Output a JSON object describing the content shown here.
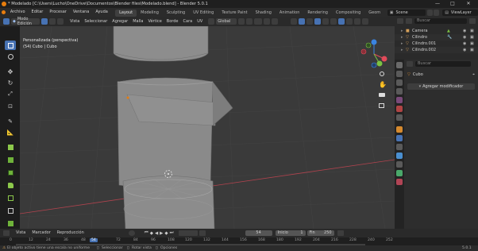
{
  "window": {
    "title": "* Modelado [C:\\Users\\Lucho\\OneDrive\\Documentos\\Blender files\\Modelado.blend] - Blender 5.0.1",
    "minimize": "—",
    "maximize": "□",
    "close": "✕"
  },
  "menubar": {
    "items": [
      "Archivo",
      "Editar",
      "Procesar",
      "Ventana",
      "Ayuda"
    ],
    "workspaces": [
      "Layout",
      "Modeling",
      "Sculpting",
      "UV Editing",
      "Texture Paint",
      "Shading",
      "Animation",
      "Rendering",
      "Compositing",
      "Geom"
    ],
    "active_workspace": "Layout",
    "scene": "Scene",
    "view_layer": "ViewLayer"
  },
  "viewport_header": {
    "mode": "Modo Edición",
    "menus": [
      "Vista",
      "Seleccionar",
      "Agregar",
      "Malla",
      "Vértice",
      "Borde",
      "Cara",
      "UV"
    ],
    "transform": "Global",
    "options": "Opciones"
  },
  "viewport": {
    "view_name": "Personalizada (perspectiva)",
    "object_info": "(54) Cubo | Cubo",
    "axes": {
      "x": "X",
      "y": "Y",
      "z": "Z"
    }
  },
  "outliner": {
    "search_placeholder": "Buscar",
    "rows": [
      {
        "name": "Camera"
      },
      {
        "name": "Cilindro"
      },
      {
        "name": "Cilindro.001"
      },
      {
        "name": "Cilindro.002"
      }
    ]
  },
  "properties": {
    "search_placeholder": "Buscar",
    "object_name": "Cubo",
    "add_modifier": "Agregar modificador"
  },
  "timeline": {
    "menus": [
      "Vista",
      "Marcador",
      "Reproducción"
    ],
    "current_frame": "54",
    "start_label": "Inicio",
    "start": "1",
    "end_label": "Fin",
    "end": "250",
    "ticks": [
      "0",
      "12",
      "24",
      "36",
      "48",
      "54",
      "72",
      "84",
      "96",
      "108",
      "120",
      "132",
      "144",
      "156",
      "168",
      "180",
      "192",
      "204",
      "216",
      "228",
      "240",
      "252"
    ]
  },
  "statusbar": {
    "left": "El objeto activo tiene una escala no uniforme",
    "select": "Seleccionar",
    "rotate": "Rotar vista",
    "options": "Opciones",
    "version": "5.0.1"
  },
  "colors": {
    "accent": "#4772b3",
    "orange": "#e87d0d",
    "axis_x": "#e24b5a",
    "axis_y": "#7cc242",
    "axis_z": "#3a84e0"
  }
}
